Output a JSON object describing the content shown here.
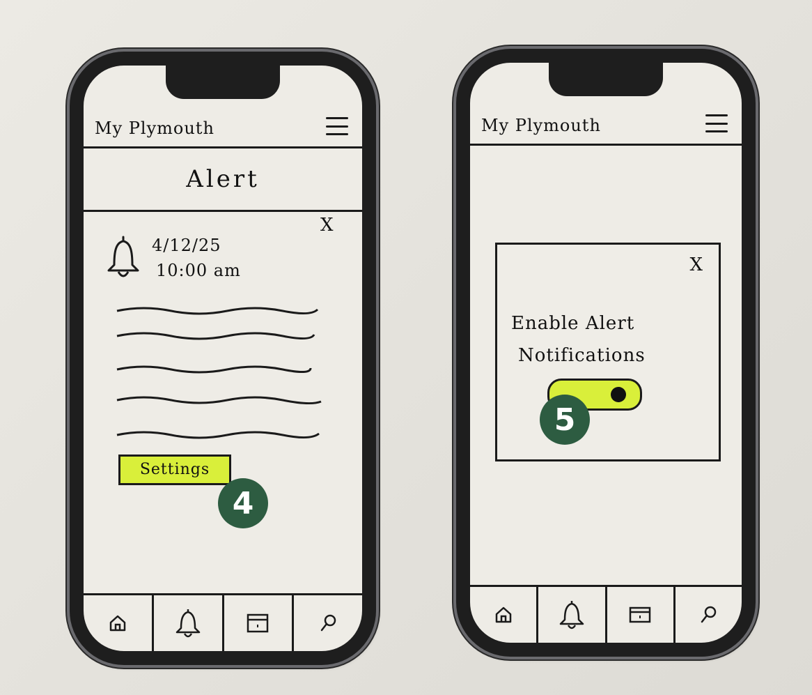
{
  "screen_left": {
    "header": {
      "app_title": "My Plymouth",
      "menu_icon": "hamburger-menu-icon"
    },
    "section_title": "Alert",
    "alert_card": {
      "close_label": "X",
      "bell_icon": "bell-icon",
      "date": "4/12/25",
      "time": "10:00 am",
      "settings_label": "Settings"
    },
    "step_badge": "4",
    "tabs": [
      {
        "icon": "home-icon"
      },
      {
        "icon": "bell-icon"
      },
      {
        "icon": "calendar-icon"
      },
      {
        "icon": "search-icon"
      }
    ]
  },
  "screen_right": {
    "header": {
      "app_title": "My Plymouth",
      "menu_icon": "hamburger-menu-icon"
    },
    "modal": {
      "close_label": "X",
      "line1": "Enable Alert",
      "line2": "Notifications",
      "toggle_state": "on"
    },
    "step_badge": "5",
    "tabs": [
      {
        "icon": "home-icon"
      },
      {
        "icon": "bell-icon"
      },
      {
        "icon": "calendar-icon"
      },
      {
        "icon": "search-icon"
      }
    ]
  },
  "colors": {
    "highlight": "#d9ef3a",
    "badge": "#2d5c41",
    "ink": "#1a1a1a",
    "paper": "#eeece6"
  }
}
